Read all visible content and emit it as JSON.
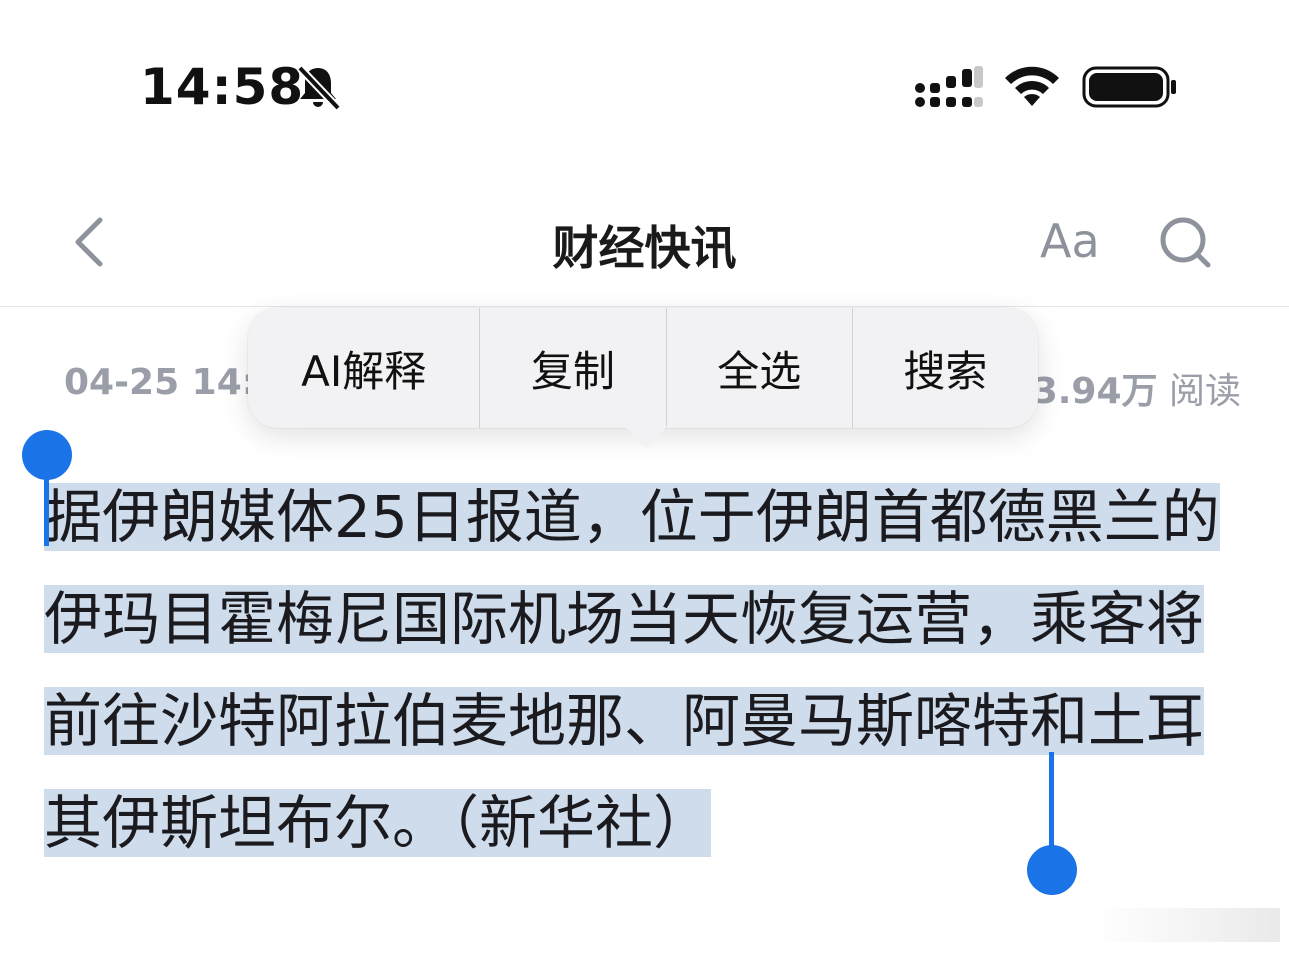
{
  "status_bar": {
    "time": "14:58",
    "icons": [
      "bell-slash-icon",
      "cellular-signal-icon",
      "wifi-icon",
      "battery-icon"
    ]
  },
  "nav": {
    "back_icon": "chevron-left-icon",
    "title": "财经快讯",
    "font_size_button": "Aa",
    "search_icon": "search-icon"
  },
  "meta": {
    "datetime": "04-25 14:3",
    "reads_count": "3.94万",
    "reads_label": "阅读"
  },
  "context_menu": {
    "items": [
      "AI解释",
      "复制",
      "全选",
      "搜索"
    ]
  },
  "article": {
    "text": "据伊朗媒体25日报道，位于伊朗首都德黑兰的伊玛目霍梅尼国际机场当天恢复运营，乘客将前往沙特阿拉伯麦地那、阿曼马斯喀特和土耳其伊斯坦布尔。（新华社）",
    "selection_color": "#cfdcec",
    "handle_color": "#1b73e8"
  }
}
